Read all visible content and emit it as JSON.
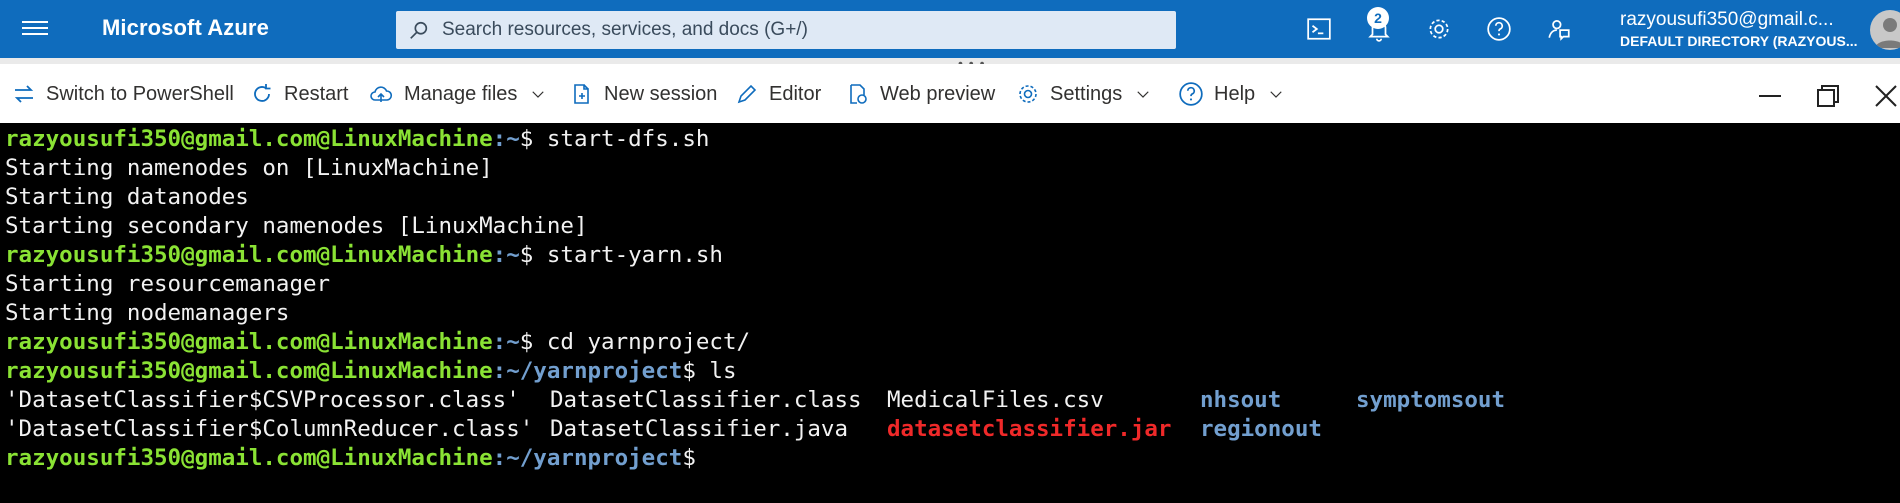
{
  "topbar": {
    "brand": "Microsoft Azure",
    "search_placeholder": "Search resources, services, and docs (G+/)",
    "notification_count": "2",
    "account_email": "razyousufi350@gmail.c...",
    "account_directory": "DEFAULT DIRECTORY (RAZYOUS...",
    "bg_color": "#0f6cbd",
    "icons": [
      "menu-icon",
      "search-icon",
      "cloud-shell-icon",
      "bell-icon",
      "gear-icon",
      "help-icon",
      "feedback-icon",
      "avatar"
    ]
  },
  "toolbar": {
    "switch_label": "Switch to PowerShell",
    "restart_label": "Restart",
    "manage_files_label": "Manage files",
    "new_session_label": "New session",
    "editor_label": "Editor",
    "web_preview_label": "Web preview",
    "settings_label": "Settings",
    "help_label": "Help"
  },
  "terminal": {
    "prompt_user": "razyousufi350@gmail.com@LinuxMachine",
    "lines": {
      "l1": {
        "path": ":~",
        "cmd": "$ start-dfs.sh"
      },
      "l2": "Starting namenodes on [LinuxMachine]",
      "l3": "Starting datanodes",
      "l4": "Starting secondary namenodes [LinuxMachine]",
      "l5": {
        "path": ":~",
        "cmd": "$ start-yarn.sh"
      },
      "l6": "Starting resourcemanager",
      "l7": "Starting nodemanagers",
      "l8": {
        "path": ":~",
        "cmd": "$ cd yarnproject/"
      },
      "l9": {
        "path": ":~/yarnproject",
        "cmd": "$ ls"
      },
      "l12": {
        "path": ":~/yarnproject",
        "cmd": "$"
      }
    },
    "ls_row1": [
      "'DatasetClassifier$CSVProcessor.class'",
      "DatasetClassifier.class",
      "MedicalFiles.csv",
      "nhsout",
      "symptomsout"
    ],
    "ls_row2": [
      "'DatasetClassifier$ColumnReducer.class'",
      "DatasetClassifier.java",
      "datasetclassifier.jar",
      "regionout"
    ],
    "colors": {
      "user": "#8ae234",
      "path": "#729fcf",
      "jar": "#ef2929",
      "dir": "#729fcf"
    }
  }
}
